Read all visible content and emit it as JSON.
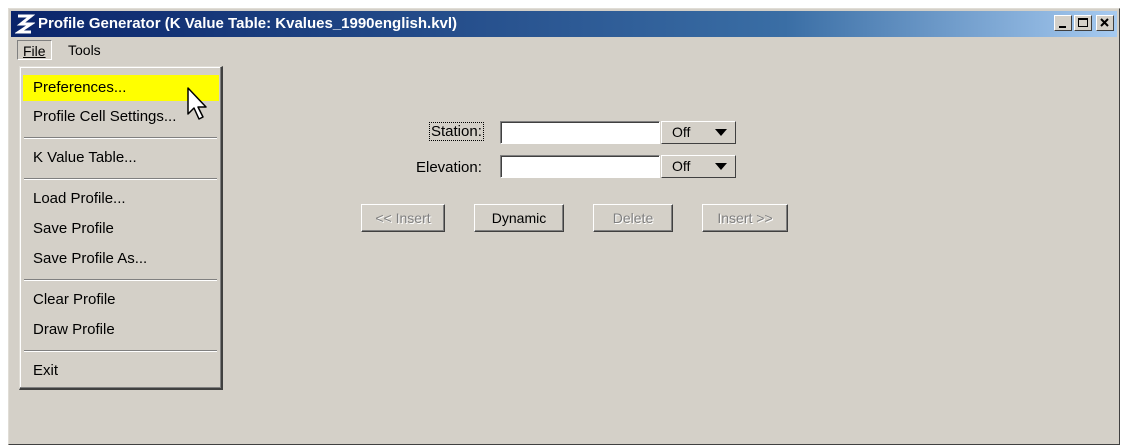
{
  "window": {
    "title": "Profile Generator  (K Value Table: Kvalues_1990english.kvl)",
    "controls": [
      "minimize",
      "maximize",
      "close"
    ]
  },
  "menubar": {
    "file": "File",
    "tools": "Tools"
  },
  "file_menu": {
    "items": [
      "Preferences...",
      "Profile Cell Settings...",
      "K Value Table...",
      "Load Profile...",
      "Save Profile",
      "Save Profile As...",
      "Clear Profile",
      "Draw Profile",
      "Exit"
    ],
    "highlighted": "Preferences..."
  },
  "form": {
    "station_label": "Station:",
    "station_value": "",
    "station_mode": "Off",
    "elevation_label": "Elevation:",
    "elevation_value": "",
    "elevation_mode": "Off"
  },
  "buttons": {
    "insert_before": "<< Insert",
    "dynamic": "Dynamic",
    "delete": "Delete",
    "insert_after": "Insert >>"
  },
  "colors": {
    "title_bar": "#0a246a",
    "highlight": "#ffff00",
    "face": "#d4d0c8"
  }
}
